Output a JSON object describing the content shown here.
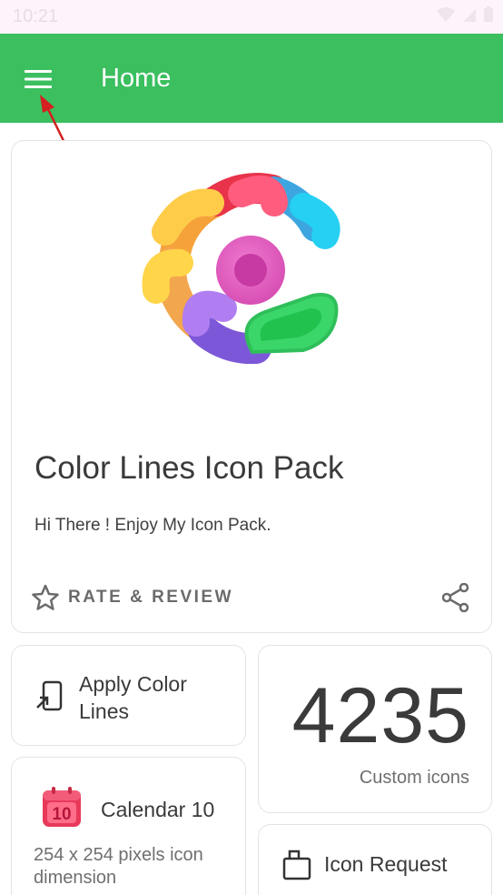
{
  "status_bar": {
    "time": "10:21"
  },
  "app_bar": {
    "title": "Home",
    "menu_icon": "hamburger-menu-icon",
    "color": "#3bbf5f"
  },
  "hero": {
    "title": "Color Lines Icon Pack",
    "subtitle": "Hi There ! Enjoy My Icon Pack.",
    "rate_label": "RATE & REVIEW",
    "rate_icon": "star-outline-icon",
    "share_icon": "share-icon"
  },
  "apply": {
    "label": "Apply Color Lines",
    "icon": "apply-launcher-icon"
  },
  "icon_count": {
    "value": "4235",
    "label": "Custom icons"
  },
  "calendar": {
    "title": "Calendar 10",
    "description": "254 x 254 pixels icon dimension",
    "icon_text": "10",
    "icon": "calendar-icon"
  },
  "icon_request": {
    "label": "Icon Request",
    "icon": "request-icon"
  }
}
